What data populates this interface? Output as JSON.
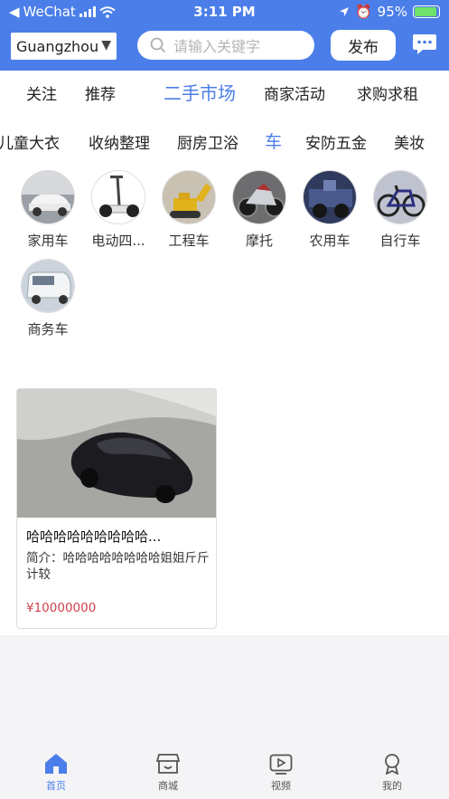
{
  "status_bar": {
    "carrier": "WeChat",
    "time": "3:11 PM",
    "battery": "95%"
  },
  "header": {
    "city": "Guangzhou",
    "search_placeholder": "请输入关键字",
    "publish_label": "发布"
  },
  "tabs": [
    "关注",
    "推荐",
    "二手市场",
    "商家活动",
    "求购求租"
  ],
  "active_tab": "二手市场",
  "subtabs": [
    "儿童大衣",
    "收纳整理",
    "厨房卫浴",
    "车",
    "安防五金",
    "美妆"
  ],
  "active_subtab": "车",
  "categories": [
    {
      "label": "家用车"
    },
    {
      "label": "电动四..."
    },
    {
      "label": "工程车"
    },
    {
      "label": "摩托"
    },
    {
      "label": "农用车"
    },
    {
      "label": "自行车"
    },
    {
      "label": "商务车"
    }
  ],
  "listing": {
    "title": "哈哈哈哈哈哈哈哈哈...",
    "desc": "简介：哈哈哈哈哈哈哈哈姐姐斤斤计较",
    "price": "¥10000000"
  },
  "bottom_nav": [
    {
      "label": "首页",
      "icon": "home-icon",
      "active": true
    },
    {
      "label": "商城",
      "icon": "shop-icon",
      "active": false
    },
    {
      "label": "视频",
      "icon": "video-icon",
      "active": false
    },
    {
      "label": "我的",
      "icon": "profile-icon",
      "active": false
    }
  ],
  "colors": {
    "accent": "#4b7ee8",
    "price": "#d0404a"
  }
}
